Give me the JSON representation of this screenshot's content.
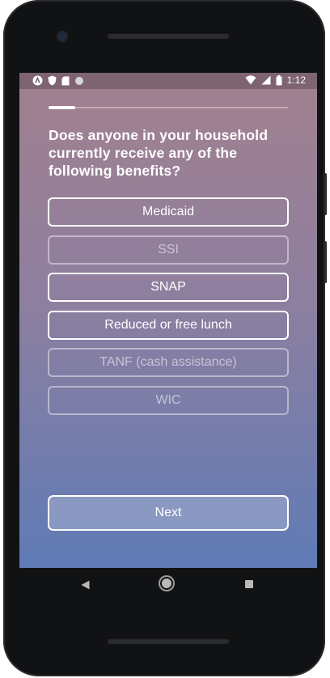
{
  "status_bar": {
    "time": "1:12",
    "left_icons": [
      "app-a-icon",
      "shield-icon",
      "sd-card-icon",
      "circle-icon"
    ],
    "right_icons": [
      "wifi-icon",
      "signal-icon",
      "battery-icon"
    ]
  },
  "survey": {
    "progress_fraction": 0.11,
    "question": "Does anyone in your household currently receive any of the following benefits?",
    "options": [
      {
        "label": "Medicaid",
        "selected": true
      },
      {
        "label": "SSI",
        "selected": false
      },
      {
        "label": "SNAP",
        "selected": true
      },
      {
        "label": "Reduced or free lunch",
        "selected": true
      },
      {
        "label": "TANF (cash assistance)",
        "selected": false
      },
      {
        "label": "WIC",
        "selected": false
      }
    ],
    "next_label": "Next"
  },
  "nav_bar": {
    "icons": [
      "back-icon",
      "home-icon",
      "recents-icon"
    ]
  }
}
